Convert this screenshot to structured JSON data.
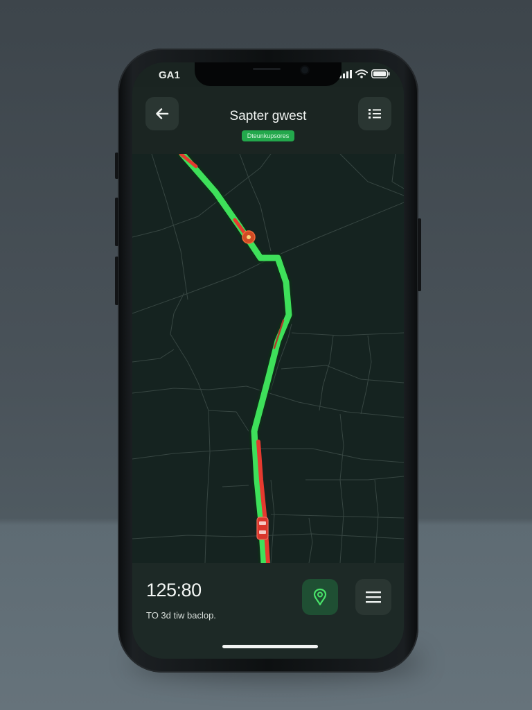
{
  "status_bar": {
    "time": "GA1",
    "icons": [
      "signal-icon",
      "wifi-icon",
      "battery-icon"
    ]
  },
  "header": {
    "back_icon": "arrow-left-icon",
    "title": "Sapter gwest",
    "badge": "Dteunkupsores",
    "menu_icon": "list-icon"
  },
  "map": {
    "route_colors": {
      "route": "#3ee05a",
      "traffic": "#e53a2f"
    },
    "markers": [
      "route-marker",
      "vehicle-marker"
    ]
  },
  "bottom_panel": {
    "eta_time": "125:80",
    "eta_subtitle": "TO 3d tiw baclop.",
    "location_icon": "location-pin-icon",
    "menu_icon": "hamburger-menu-icon"
  },
  "colors": {
    "accent": "#3ee05a",
    "alert": "#e53a2f",
    "screen_bg": "#1a2421",
    "map_bg": "#152320"
  }
}
